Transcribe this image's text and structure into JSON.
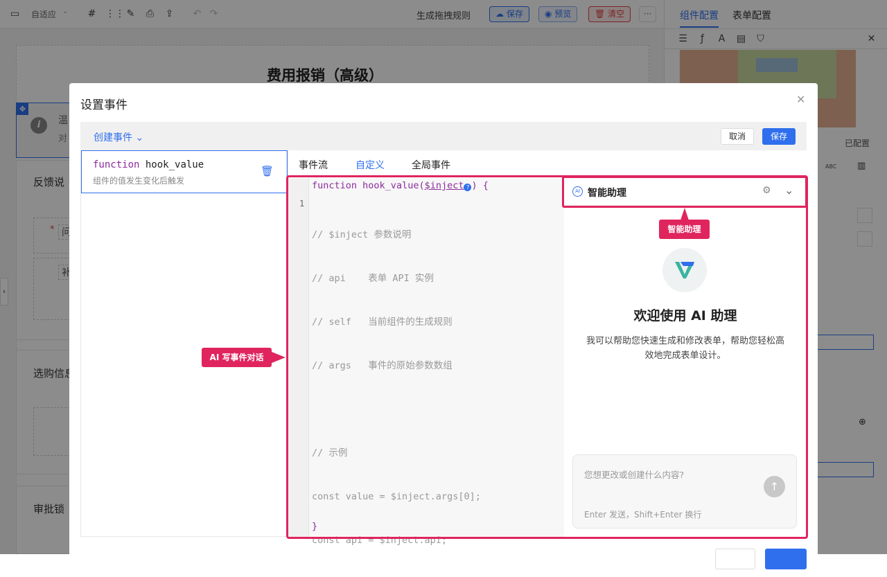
{
  "toolbar": {
    "adaptive_label": "自适应",
    "generate_rules": "生成拖拽规则",
    "save": "保存",
    "preview": "预览",
    "clear": "清空",
    "more": "···"
  },
  "right_panel": {
    "tab_component": "组件配置",
    "tab_form": "表单配置",
    "configured": "已配置",
    "abc": "ABC"
  },
  "form": {
    "title": "费用报销（高级）",
    "notice_title": "温",
    "notice_sub": "对",
    "feedback_label": "反馈说",
    "question_label": "问",
    "supplement_label": "补",
    "purchase_label": "选购信息",
    "approval_label": "审批锁"
  },
  "modal": {
    "title": "设置事件",
    "create_event": "创建事件",
    "cancel": "取消",
    "save": "保存",
    "event_keyword": "function",
    "event_name": "hook_value",
    "event_desc": "组件的值发生变化后触发",
    "tabs": [
      "事件流",
      "自定义",
      "全局事件"
    ],
    "active_tab": "自定义"
  },
  "code": {
    "signature_kw": "function",
    "signature_name": "hook_value(",
    "signature_param": "$inject",
    "signature_end": ") {",
    "line_number": "1",
    "lines": [
      "// $inject 参数说明",
      "// api    表单 API 实例",
      "// self   当前组件的生成规则",
      "// args   事件的原始参数数组",
      "",
      "// 示例",
      "const value = $inject.args[0];",
      "const api = $inject.api;"
    ],
    "closing": "}"
  },
  "assistant": {
    "title": "智能助理",
    "welcome": "欢迎使用 AI 助理",
    "desc": "我可以帮助您快速生成和修改表单，帮助您轻松高效地完成表单设计。",
    "input_placeholder": "您想更改或创建什么内容?",
    "hint": "Enter 发送，Shift+Enter 换行"
  },
  "callouts": {
    "assistant_label": "智能助理",
    "ai_event_label": "AI 写事件对话"
  },
  "colors": {
    "primary": "#2f6fed",
    "accent": "#e0245e",
    "danger": "#e04343"
  }
}
